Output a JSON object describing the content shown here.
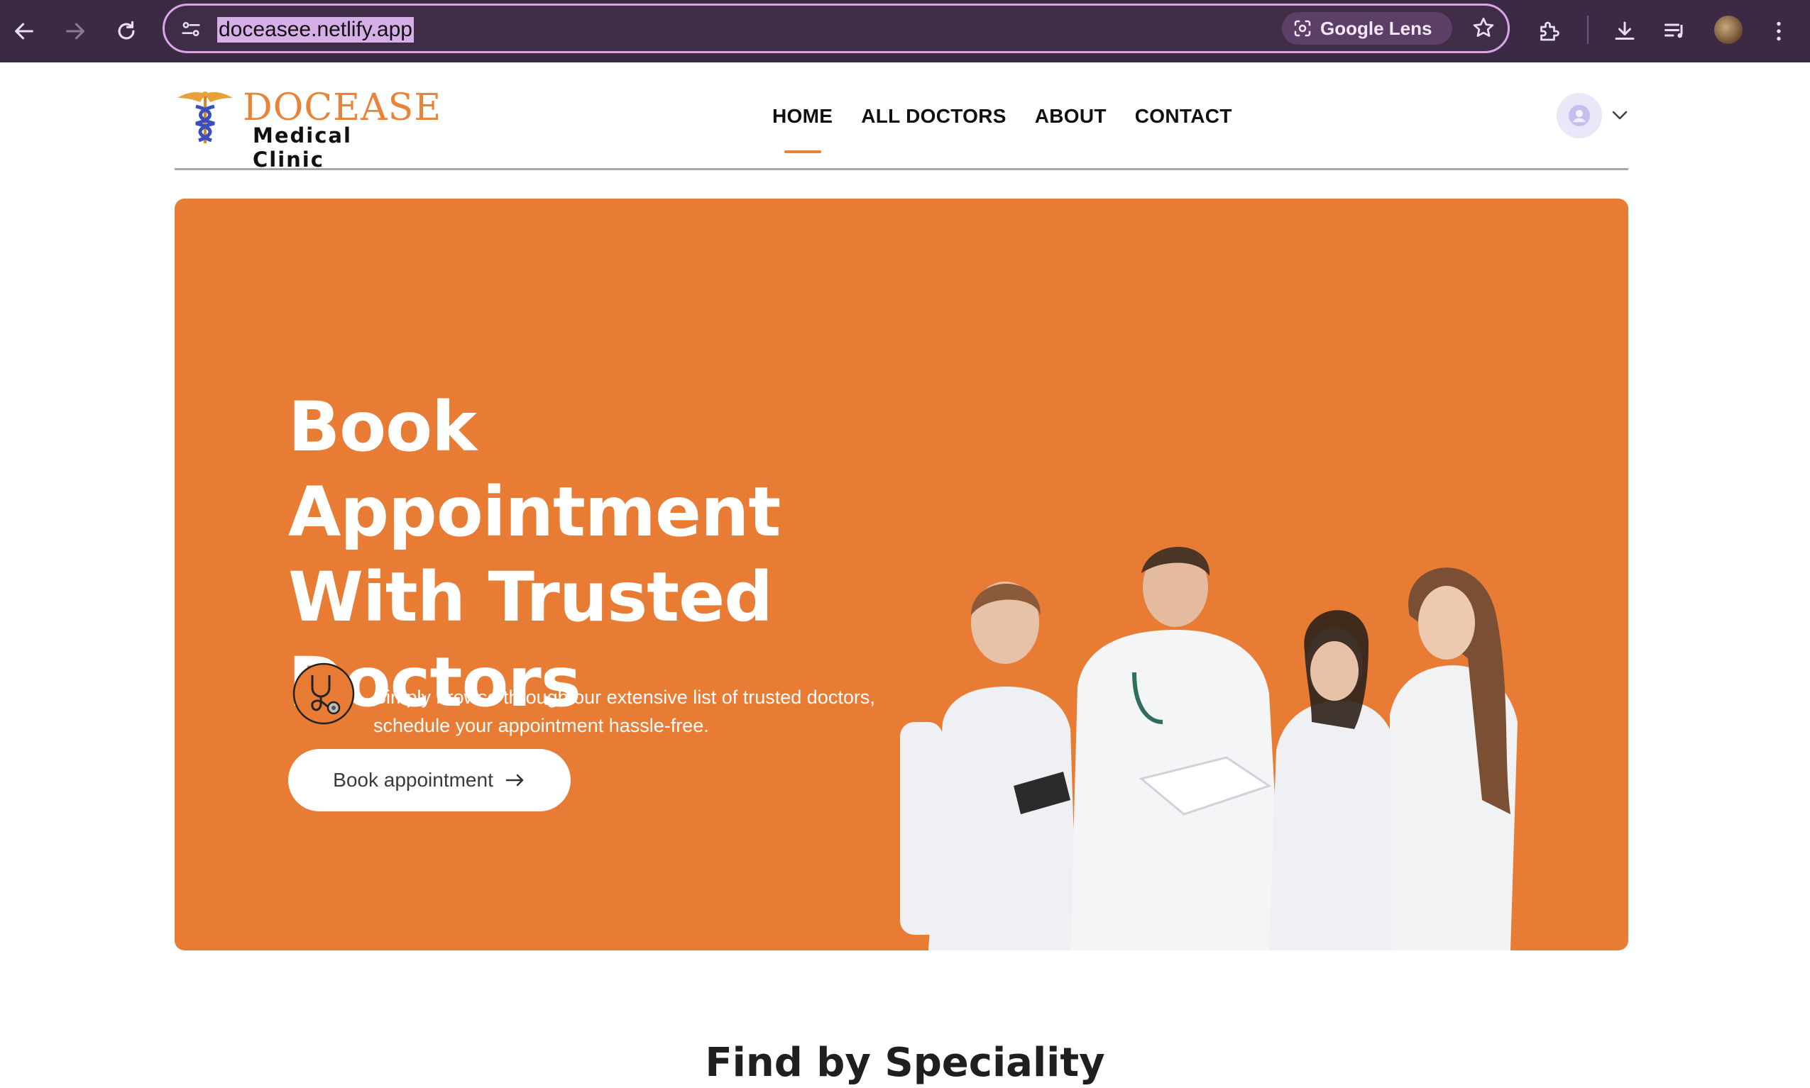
{
  "browser": {
    "url": "doceasee.netlify.app",
    "lens_label": "Google Lens"
  },
  "site": {
    "brand": "DOCEASE",
    "subtitle": "Medical Clinic",
    "nav": [
      {
        "label": "HOME",
        "active": true
      },
      {
        "label": "ALL DOCTORS",
        "active": false
      },
      {
        "label": "ABOUT",
        "active": false
      },
      {
        "label": "CONTACT",
        "active": false
      }
    ]
  },
  "hero": {
    "title_lines": [
      "Book Appointment",
      "With Trusted",
      "Doctors"
    ],
    "description_lines": [
      "Simply browse through our extensive list of trusted doctors,",
      "schedule your appointment hassle-free."
    ],
    "button_label": "Book appointment",
    "background_color": "#e87c35"
  },
  "next_section": {
    "title": "Find by Speciality"
  },
  "colors": {
    "accent": "#e87c35",
    "chrome": "#3c2a44",
    "omnibox_border": "#dba5e7"
  },
  "icons": [
    "back-icon",
    "forward-icon",
    "reload-icon",
    "site-info-icon",
    "google-lens-icon",
    "bookmark-star-icon",
    "extensions-icon",
    "download-icon",
    "media-icon",
    "profile-avatar",
    "kebab-menu-icon",
    "caduceus-logo",
    "user-icon",
    "chevron-down-icon",
    "stethoscope-icon",
    "arrow-right-icon"
  ]
}
